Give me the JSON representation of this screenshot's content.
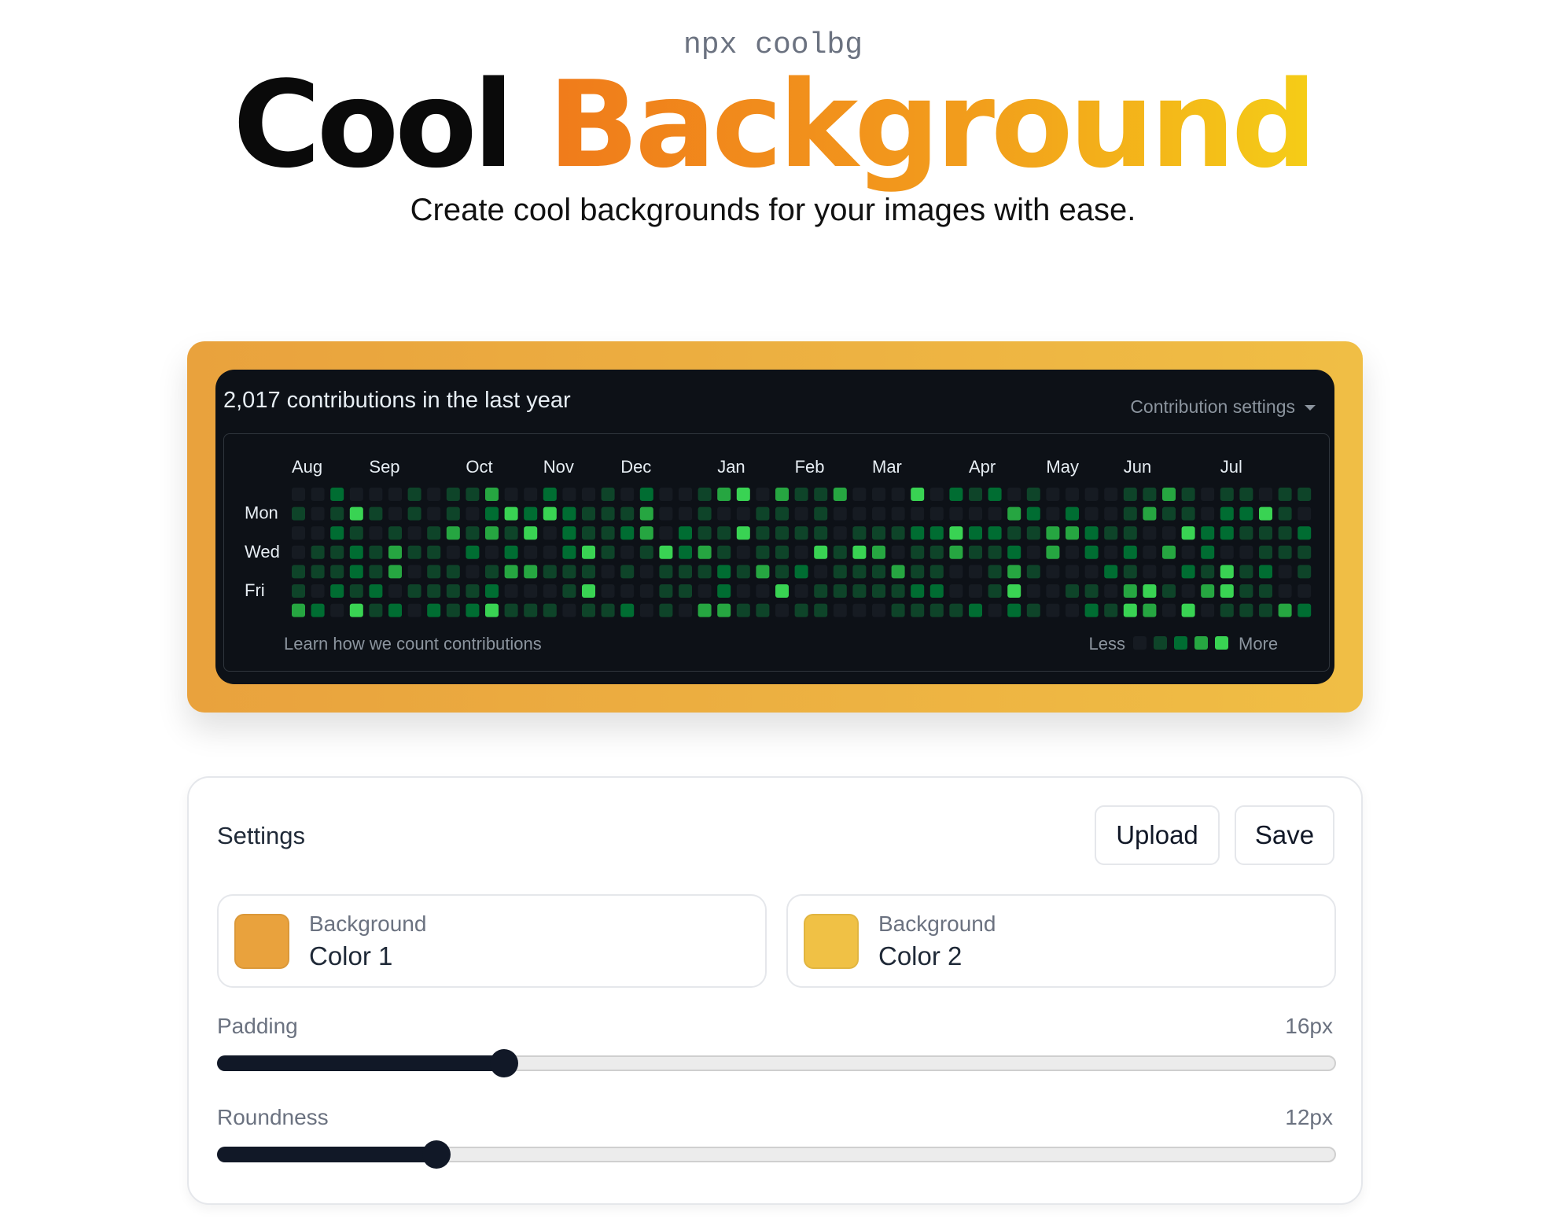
{
  "header": {
    "command": "npx coolbg",
    "title_word1": "Cool",
    "title_word2": "Background",
    "subtitle": "Create cool backgrounds for your images with ease."
  },
  "preview": {
    "colors": {
      "background_1": "#e9a23d",
      "background_2": "#f0be45"
    },
    "contributions": {
      "heading": "2,017 contributions in the last year",
      "settings_label": "Contribution settings",
      "months": [
        "Aug",
        "Sep",
        "Oct",
        "Nov",
        "Dec",
        "Jan",
        "Feb",
        "Mar",
        "Apr",
        "May",
        "Jun",
        "Jul"
      ],
      "day_labels": [
        "Mon",
        "Wed",
        "Fri"
      ],
      "footer_link": "Learn how we count contributions",
      "legend_less": "Less",
      "legend_more": "More",
      "level_colors": [
        "#161b22",
        "#0e4429",
        "#006d32",
        "#26a641",
        "#39d353"
      ]
    }
  },
  "settings": {
    "title": "Settings",
    "upload_label": "Upload",
    "save_label": "Save",
    "color1": {
      "label": "Background",
      "value": "Color 1",
      "swatch": "#e9a23d"
    },
    "color2": {
      "label": "Background",
      "value": "Color 2",
      "swatch": "#f0c145"
    },
    "padding": {
      "label": "Padding",
      "value": "16px",
      "level": 0.255
    },
    "roundness": {
      "label": "Roundness",
      "value": "12px",
      "level": 0.195
    }
  }
}
